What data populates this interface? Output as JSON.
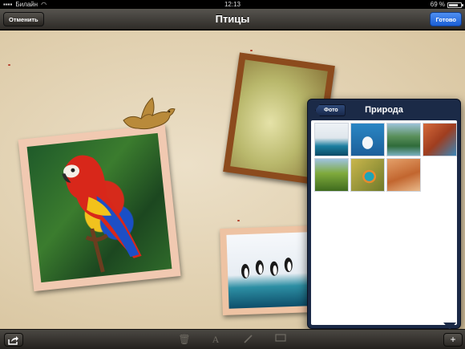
{
  "status_bar": {
    "carrier": "Билайн",
    "time": "12:13",
    "battery": "69 %"
  },
  "nav": {
    "cancel_label": "Отменить",
    "title": "Птицы",
    "done_label": "Готово"
  },
  "album": {
    "photos": [
      {
        "subject": "parrot"
      },
      {
        "subject": "bird-blur"
      },
      {
        "subject": "penguins"
      }
    ],
    "sticker": "dove-icon"
  },
  "popover": {
    "back_label": "Фото",
    "title": "Природа",
    "thumbnails": [
      {
        "subject": "penguins"
      },
      {
        "subject": "polar-bear"
      },
      {
        "subject": "river-valley"
      },
      {
        "subject": "red-canyon"
      },
      {
        "subject": "green-hills"
      },
      {
        "subject": "kingfisher"
      },
      {
        "subject": "desert-dunes"
      }
    ]
  },
  "toolbar": {
    "share": "share-icon",
    "trash": "trash-icon",
    "text": "A",
    "pen": "pen-icon",
    "frame": "frame-icon",
    "add": "+"
  },
  "colors": {
    "done_button": "#1a5ed6",
    "popover": "#1b2a47",
    "parrot_frame": "#f1c9b1",
    "wood_frame": "#8c4b1d"
  }
}
